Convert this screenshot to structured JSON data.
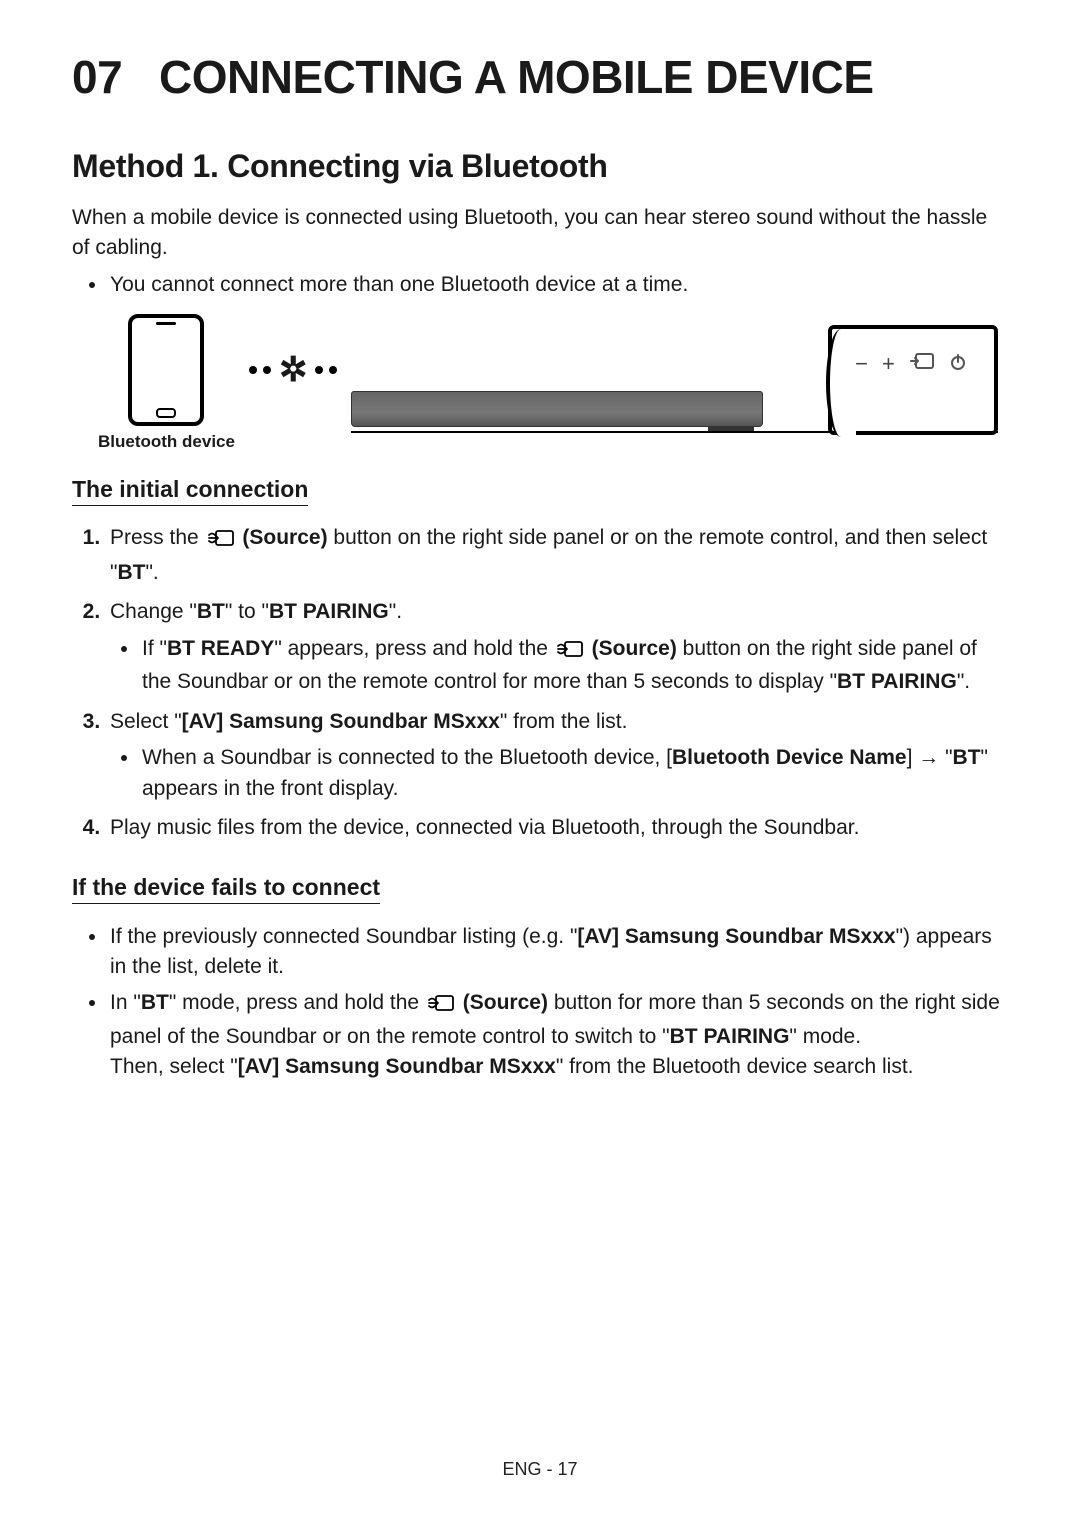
{
  "chapter_no": "07",
  "chapter_title": "CONNECTING A MOBILE DEVICE",
  "method_title": "Method 1. Connecting via Bluetooth",
  "intro": "When a mobile device is connected using Bluetooth, you can hear stereo sound without the hassle of cabling.",
  "intro_bullet": "You cannot connect more than one Bluetooth device at a time.",
  "figure": {
    "bt_device_label": "Bluetooth device",
    "tv_panel_icons": [
      "−",
      "+",
      "source-icon",
      "power-icon"
    ]
  },
  "sub1_title": "The initial connection",
  "steps": {
    "s1_pre": "Press the ",
    "s1_source": "(Source)",
    "s1_post": " button on the right side panel or on the remote control, and then select \"",
    "s1_bt": "BT",
    "s1_end": "\".",
    "s2_pre": "Change \"",
    "s2_bt": "BT",
    "s2_mid": "\" to \"",
    "s2_btp": "BT PAIRING",
    "s2_end": "\".",
    "s2b_pre": "If \"",
    "s2b_ready": "BT READY",
    "s2b_mid1": "\" appears, press and hold the ",
    "s2b_source": "(Source)",
    "s2b_mid2": " button on the right side panel of the Soundbar or on the remote control for more than 5 seconds to display \"",
    "s2b_btp": "BT PAIRING",
    "s2b_end": "\".",
    "s3_pre": "Select \"",
    "s3_av": "[AV] Samsung Soundbar MSxxx",
    "s3_post": "\" from the list.",
    "s3b_pre": "When a Soundbar is connected to the Bluetooth device, [",
    "s3b_name": "Bluetooth Device Name",
    "s3b_mid": "] → \"",
    "s3b_bt": "BT",
    "s3b_post": "\" appears in the front display.",
    "s4": "Play music files from the device, connected via Bluetooth, through the Soundbar."
  },
  "sub2_title": "If the device fails to connect",
  "fail": {
    "b1_pre": "If the previously connected Soundbar listing (e.g. \"",
    "b1_av": "[AV] Samsung Soundbar MSxxx",
    "b1_post": "\") appears in the list, delete it.",
    "b2_pre": "In \"",
    "b2_bt": "BT",
    "b2_mid1": "\" mode, press and hold the ",
    "b2_source": "(Source)",
    "b2_mid2": " button for more than 5 seconds on the right side panel of the Soundbar or on the remote control to switch to \"",
    "b2_btp": "BT PAIRING",
    "b2_mid3": "\" mode.",
    "b2_then_pre": "Then, select \"",
    "b2_av": "[AV] Samsung Soundbar MSxxx",
    "b2_then_post": "\" from the Bluetooth device search list."
  },
  "footer": "ENG - 17"
}
